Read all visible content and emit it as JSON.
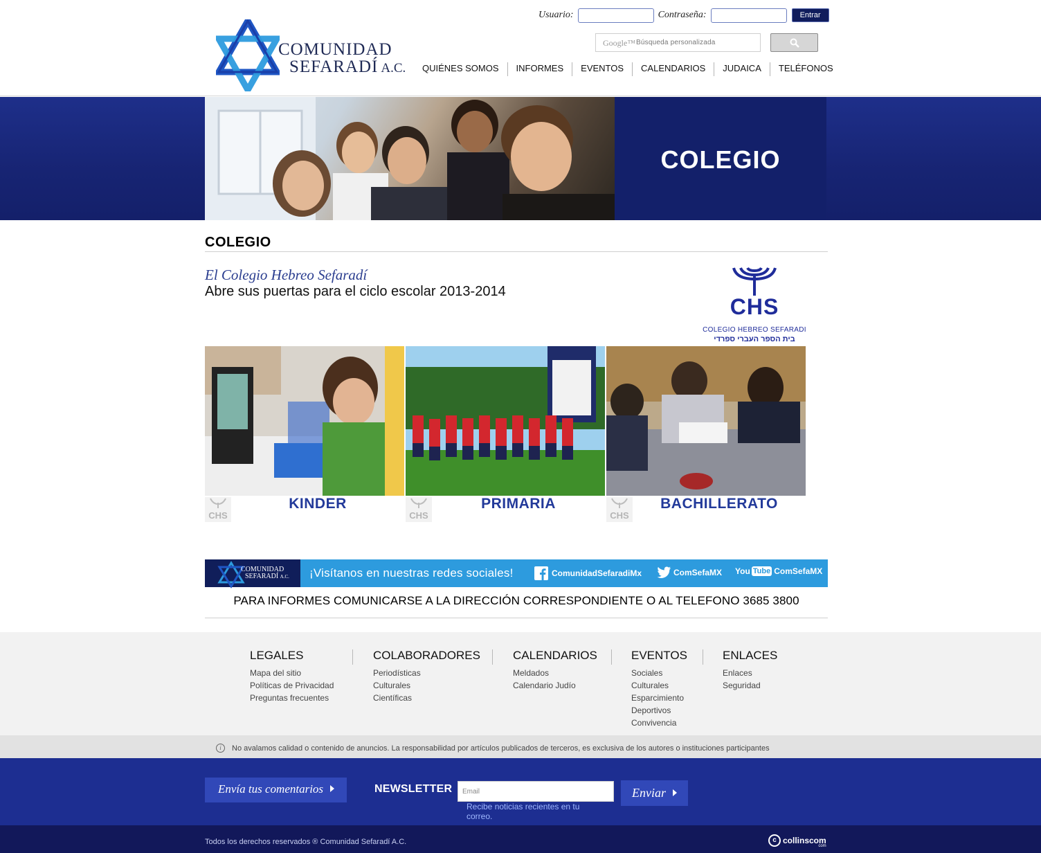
{
  "header": {
    "logo": {
      "line1": "COMUNIDAD",
      "line2": "SEFARADÍ",
      "suffix": "A.C."
    },
    "login": {
      "user_label": "Usuario:",
      "password_label": "Contraseña:",
      "submit_label": "Entrar"
    },
    "search": {
      "brand": "Google™",
      "placeholder": "Búsqueda personalizada",
      "button_icon": "search-icon"
    },
    "nav": [
      "QUIÉNES SOMOS",
      "INFORMES",
      "EVENTOS",
      "CALENDARIOS",
      "JUDAICA",
      "TELÉFONOS"
    ]
  },
  "banner": {
    "title": "COLEGIO"
  },
  "main": {
    "section_title": "COLEGIO",
    "intro_line1": "El Colegio Hebreo Sefaradí",
    "intro_line2": "Abre sus puertas para el ciclo escolar 2013-2014",
    "chs_logo": {
      "acronym": "CHS",
      "name": "COLEGIO HEBREO SEFARADI",
      "hebrew": "בית הספר העברי ספרדי"
    },
    "levels": [
      {
        "label": "KINDER",
        "badge": "CHS"
      },
      {
        "label": "PRIMARIA",
        "badge": "CHS"
      },
      {
        "label": "BACHILLERATO",
        "badge": "CHS"
      }
    ]
  },
  "social": {
    "logo_line1": "COMUNIDAD",
    "logo_line2": "SEFARADÍ",
    "logo_suffix": "A.C.",
    "invite": "¡Visítanos en nuestras redes sociales!",
    "facebook": "ComunidadSefaradiMx",
    "twitter": "ComSefaMX",
    "youtube_you": "You",
    "youtube_tube": "Tube",
    "youtube": "ComSefaMX"
  },
  "informes": "PARA INFORMES COMUNICARSE A LA DIRECCIÓN CORRESPONDIENTE O AL TELEFONO 3685 3800",
  "footer": {
    "columns": [
      {
        "title": "LEGALES",
        "items": [
          "Mapa del sitio",
          "Políticas de Privacidad",
          "Preguntas frecuentes"
        ]
      },
      {
        "title": "COLABORADORES",
        "items": [
          "Periodísticas",
          "Culturales",
          "Científicas"
        ]
      },
      {
        "title": "CALENDARIOS",
        "items": [
          "Meldados",
          "Calendario Judío"
        ]
      },
      {
        "title": "EVENTOS",
        "items": [
          "Sociales",
          "Culturales",
          "Esparcimiento",
          "Deportivos",
          "Convivencia"
        ]
      },
      {
        "title": "ENLACES",
        "items": [
          "Enlaces",
          "Seguridad"
        ]
      }
    ],
    "disclaimer": "No avalamos calidad o contenido de anuncios. La responsabilidad por artículos publicados de terceros, es exclusiva de los autores o instituciones participantes",
    "comment_button": "Envía tus comentarios",
    "newsletter_label": "NEWSLETTER",
    "email_placeholder": "Email",
    "newsletter_note": "Recibe noticias recientes en tu correo.",
    "send_button": "Enviar",
    "copyright": "Todos los derechos reservados ® Comunidad Sefaradí A.C.",
    "credit": "collinscom",
    "credit_small": "com"
  },
  "colors": {
    "brand_navy": "#13206a",
    "link_blue": "#233a9a",
    "social_blue": "#2d9bde",
    "footer_blue": "#1d2e91"
  }
}
